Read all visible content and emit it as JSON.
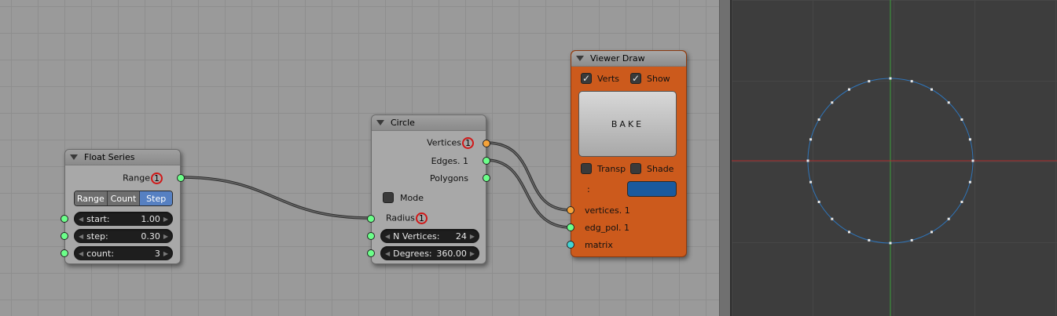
{
  "float_series": {
    "title": "Float Series",
    "output_label": "Range",
    "output_badge": "1",
    "modes": [
      {
        "label": "Range",
        "active": false
      },
      {
        "label": "Count",
        "active": false
      },
      {
        "label": "Step",
        "active": true
      }
    ],
    "fields": [
      {
        "label": "start:",
        "value": "1.00"
      },
      {
        "label": "step:",
        "value": "0.30"
      },
      {
        "label": "count:",
        "value": "3"
      }
    ]
  },
  "circle": {
    "title": "Circle",
    "outputs": {
      "vertices_label": "Vertices",
      "vertices_badge": "1",
      "edges_label": "Edges. 1",
      "polygons_label": "Polygons"
    },
    "mode_label": "Mode",
    "radius_label": "Radius",
    "radius_badge": "1",
    "fields": [
      {
        "label": "N Vertices:",
        "value": "24"
      },
      {
        "label": "Degrees:",
        "value": "360.00"
      }
    ]
  },
  "viewer_draw": {
    "title": "Viewer Draw",
    "verts_label": "Verts",
    "verts_checked": true,
    "show_label": "Show",
    "show_checked": true,
    "bake_label": "BAKE",
    "transp_label": "Transp",
    "transp_checked": false,
    "shade_label": "Shade",
    "shade_checked": false,
    "color_label": ":",
    "color_value": "#1a5a9e",
    "inputs": {
      "vertices_label": "vertices. 1",
      "edg_pol_label": "edg_pol. 1",
      "matrix_label": "matrix"
    },
    "node_color": "#cc5a1c"
  },
  "viewport": {
    "circle_vertex_count": 24,
    "x_axis_color": "#b03030",
    "y_axis_color": "#3aa03a",
    "wire_color": "#2f74b8"
  }
}
